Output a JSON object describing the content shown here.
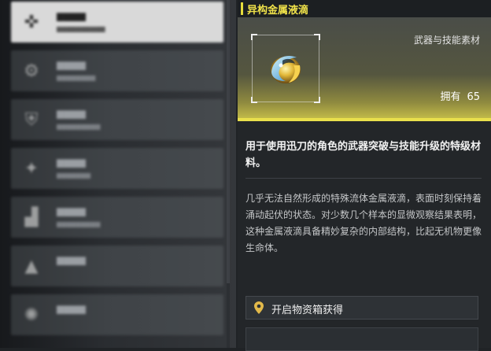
{
  "item": {
    "name": "异构金属液滴",
    "category": "武器与技能素材",
    "owned_label": "拥有",
    "owned_count": "65",
    "usage": "用于使用迅刀的角色的武器突破与技能升级的特级材料。",
    "lore": "几乎无法自然形成的特殊流体金属液滴，表面时刻保持着涌动起伏的状态。对少数几个样本的显微观察结果表明，这种金属液滴具备精妙复杂的内部结构，比起无机物更像生命体。",
    "source": "开启物资箱获得"
  },
  "colors": {
    "accent": "#e9e04c",
    "title": "#f0e24a"
  },
  "menu_icons": [
    "crosshair-icon",
    "gear-icon",
    "shield-icon",
    "star-icon",
    "chart-icon",
    "warning-icon",
    "swirl-icon"
  ]
}
